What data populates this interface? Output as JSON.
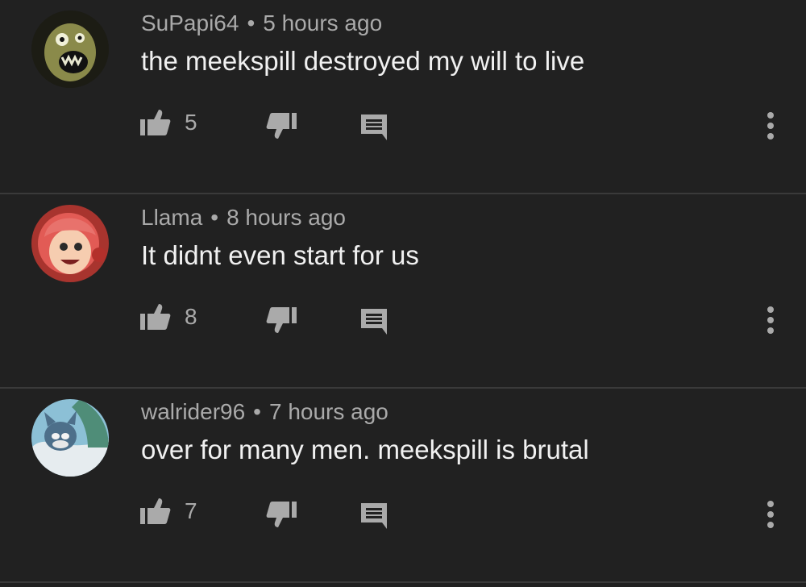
{
  "comments": [
    {
      "author": "SuPapi64",
      "separator": "•",
      "time": "5 hours ago",
      "text": "the meekspill destroyed my will to live",
      "likes": "5",
      "avatar_colors": [
        "#2b2b20",
        "#8a8a4a"
      ]
    },
    {
      "author": "Llama",
      "separator": "•",
      "time": "8 hours ago",
      "text": "It didnt even start for us",
      "likes": "8",
      "avatar_colors": [
        "#c8423a",
        "#f2c0a0"
      ]
    },
    {
      "author": "walrider96",
      "separator": "•",
      "time": "7 hours ago",
      "text": "over for many men. meekspill is brutal",
      "likes": "7",
      "avatar_colors": [
        "#7fb0c8",
        "#3a6d7a"
      ]
    }
  ],
  "icons": {
    "like": "thumbs-up-icon",
    "dislike": "thumbs-down-icon",
    "reply": "comment-reply-icon",
    "more": "more-vertical-icon"
  },
  "colors": {
    "background": "#212121",
    "primary_text": "#f1f1f1",
    "secondary_text": "#aaaaaa",
    "divider": "#3a3a3a"
  }
}
